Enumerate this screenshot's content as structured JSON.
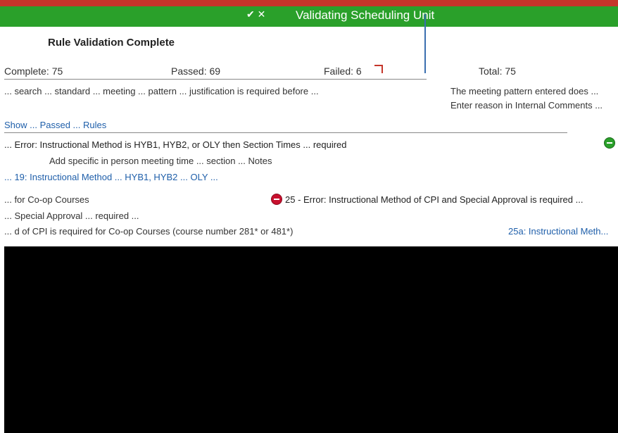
{
  "header": {
    "title": "Validating Scheduling Unit"
  },
  "summary": {
    "title": "Rule Validation Complete",
    "complete": "Complete: 75",
    "passed": "Passed: 69",
    "failed": "Failed: 6",
    "total": "Total: 75"
  },
  "rows": {
    "justification": "... search ... standard ... meeting ... pattern ... justification is required before ...",
    "meeting_pattern_note": "The meeting pattern entered does ...",
    "enter_reason": "Enter reason in Internal Comments ...",
    "show_passed": "Show ... Passed ... Rules",
    "rule_error_1": "... Error: Instructional Method is HYB1, HYB2, or OLY then Section Times ... required",
    "rule_1_desc": "Add specific in person meeting time ... section ... Notes",
    "rule_1_link": "... 19: Instructional Method ... HYB1, HYB2 ... OLY ...",
    "coop_label": "... for Co-op Courses",
    "rule_error_25": "25 - Error: Instructional Method of CPI and Special Approval is required ...",
    "coop_desc": "... Special Approval ... required ...",
    "coop_sentence": "... d of CPI is required for Co-op Courses (course number 281* or 481*)",
    "rule_25a": "25a: Instructional Meth..."
  },
  "colors": {
    "top_bar": "#2aa02a",
    "top_strip": "#c5352a",
    "link": "#1f5faa",
    "error": "#c8102e",
    "success": "#2aa02a"
  }
}
